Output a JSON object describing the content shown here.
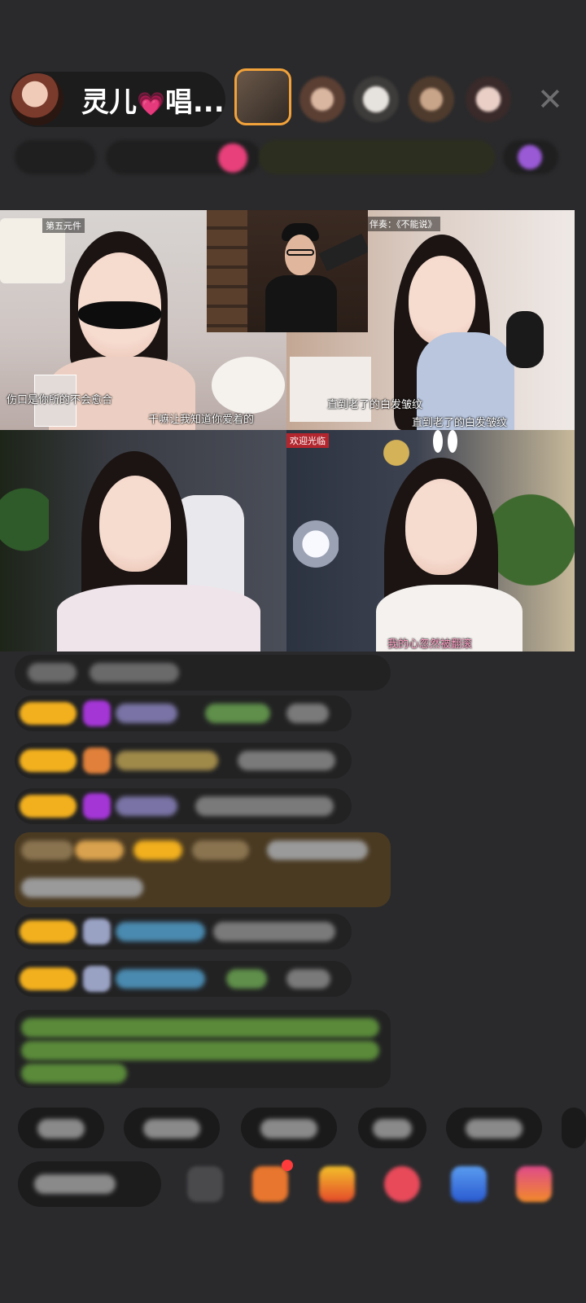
{
  "header": {
    "host_name": "灵儿",
    "host_name_suffix": "唱...",
    "close_label": "✕"
  },
  "videos": {
    "tile1": {
      "top_tag": "第五元件",
      "caption_left": "伤口是你所的不会愈合",
      "caption_right": "千嘛让我知道你爱着的"
    },
    "tile3": {
      "top_tag": "伴奏：《不能说》",
      "caption_1": "直到老了的白发皱纹",
      "caption_2": "直到老了的白发皱纹"
    },
    "tile5": {
      "top_tag": "欢迎光临",
      "caption": "我的心忽然被翻滚"
    }
  },
  "colors": {
    "badge": "#f2b01e",
    "accent_border": "#f2a23a",
    "chat_highlight": "#4a3a22",
    "chat_green_text": "#6ec24a"
  }
}
